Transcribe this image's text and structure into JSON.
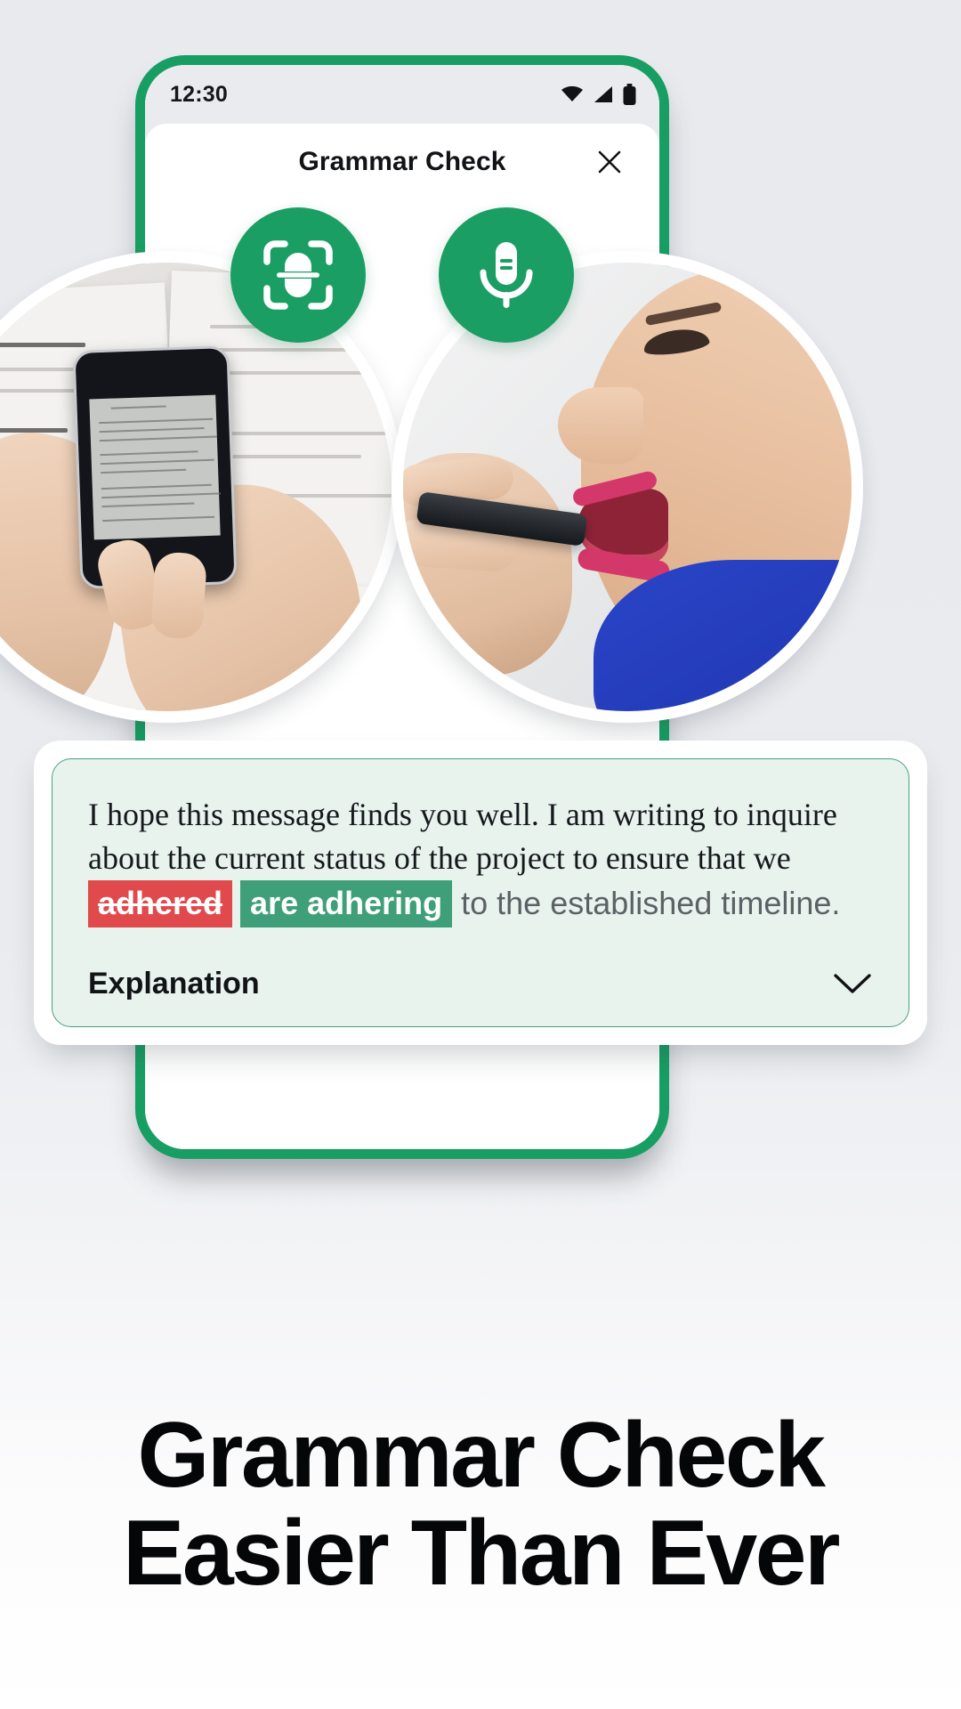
{
  "background": {
    "page_bg_top": "#e8eaee",
    "page_bg_bottom": "#ffffff"
  },
  "theme": {
    "brand_green": "#1b9e63",
    "frame_green": "#189e63",
    "card_bg": "#e9f3ee",
    "card_border": "#4a9e7c",
    "error_red": "#e04a4c",
    "suggest_green": "#3f9f79"
  },
  "phone": {
    "status_bar": {
      "time": "12:30",
      "icons": [
        "wifi-icon",
        "cellular-signal-icon",
        "battery-icon"
      ]
    },
    "app_header": {
      "title": "Grammar Check",
      "close_icon": "close-icon"
    },
    "actions": [
      {
        "id": "scan",
        "icon": "document-scan-icon",
        "label": "Scan"
      },
      {
        "id": "voice",
        "icon": "microphone-icon",
        "label": "Voice"
      }
    ]
  },
  "photos": [
    {
      "id": "scan-photo",
      "alt": "Hands holding a phone scanning a printed document on a desk"
    },
    {
      "id": "voice-photo",
      "alt": "Woman speaking into a smartphone with sound waves"
    }
  ],
  "result_card": {
    "sentence": {
      "part1": "I hope this message finds you well. I am writing to inquire about the current status of the project to ensure that we ",
      "wrong_word": "adhered",
      "suggested_word": "are adhering",
      "part2": " to the established timeline."
    },
    "explanation": {
      "label": "Explanation",
      "chevron_icon": "chevron-down-icon",
      "expanded": false
    }
  },
  "headline": {
    "line1": "Grammar Check",
    "line2": "Easier Than Ever"
  }
}
